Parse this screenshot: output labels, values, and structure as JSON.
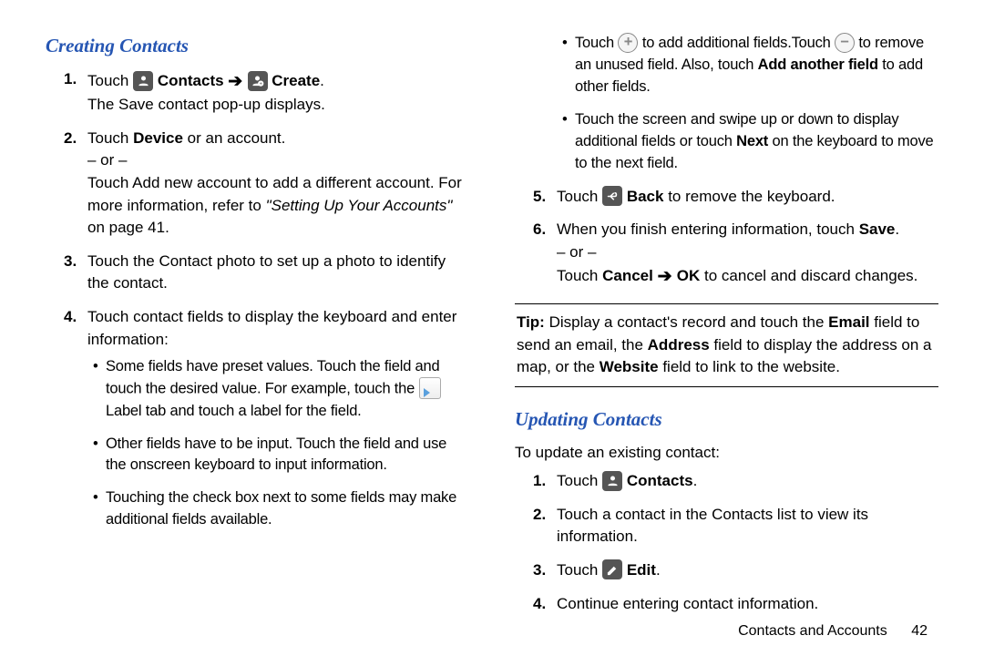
{
  "left": {
    "heading": "Creating Contacts",
    "s1_touch": "Touch ",
    "s1_contacts": "Contacts",
    "s1_create": "Create",
    "s1_period": ".",
    "s1b": "The Save contact pop-up displays.",
    "s2a": "Touch ",
    "s2_device": "Device",
    "s2b": " or an account.",
    "s2_or": "– or –",
    "s2c": "Touch Add new account to add a different account. For more information, refer to ",
    "s2_ref": "\"Setting Up Your Accounts\"",
    "s2d": " on page 41.",
    "s3": "Touch the Contact photo to set up a photo to identify the contact.",
    "s4": "Touch contact fields to display the keyboard and enter information:",
    "b1a": "Some fields have preset values. Touch the field and touch the desired value. For example, touch the ",
    "b1b": " Label tab and touch a label for the field.",
    "b2": "Other fields have to be input. Touch the field and use the onscreen keyboard to input information.",
    "b3": "Touching the check box next to some fields may make additional fields available."
  },
  "right": {
    "b4a": "Touch ",
    "b4b": " to add additional fields.Touch ",
    "b4c": " to remove an unused field. Also, touch ",
    "b4_addanother": "Add another field",
    "b4d": " to add other fields.",
    "b5a": "Touch the screen and swipe up or down to display additional fields or touch ",
    "b5_next": "Next",
    "b5b": " on the keyboard to move to the next field.",
    "s5a": "Touch ",
    "s5_back": "Back",
    "s5b": " to remove the keyboard.",
    "s6a": "When you finish entering information, touch ",
    "s6_save": "Save",
    "s6b": ".",
    "s6_or": "– or –",
    "s6c": "Touch ",
    "s6_cancel": "Cancel",
    "s6_ok": "OK",
    "s6d": " to cancel and discard changes.",
    "tip_label": "Tip:",
    "tip_a": " Display a contact's record and touch the ",
    "tip_email": "Email",
    "tip_b": " field to send an email, the ",
    "tip_address": "Address",
    "tip_c": " field to display the address on a map, or the ",
    "tip_website": "Website",
    "tip_d": " field to link to the website.",
    "heading2": "Updating Contacts",
    "u_intro": "To update an existing contact:",
    "u1a": "Touch ",
    "u1_contacts": "Contacts",
    "u1b": ".",
    "u2": "Touch a contact in the Contacts list to view its information.",
    "u3a": "Touch ",
    "u3_edit": "Edit",
    "u3b": ".",
    "u4": "Continue entering contact information."
  },
  "footer": {
    "section": "Contacts and Accounts",
    "page": "42"
  }
}
